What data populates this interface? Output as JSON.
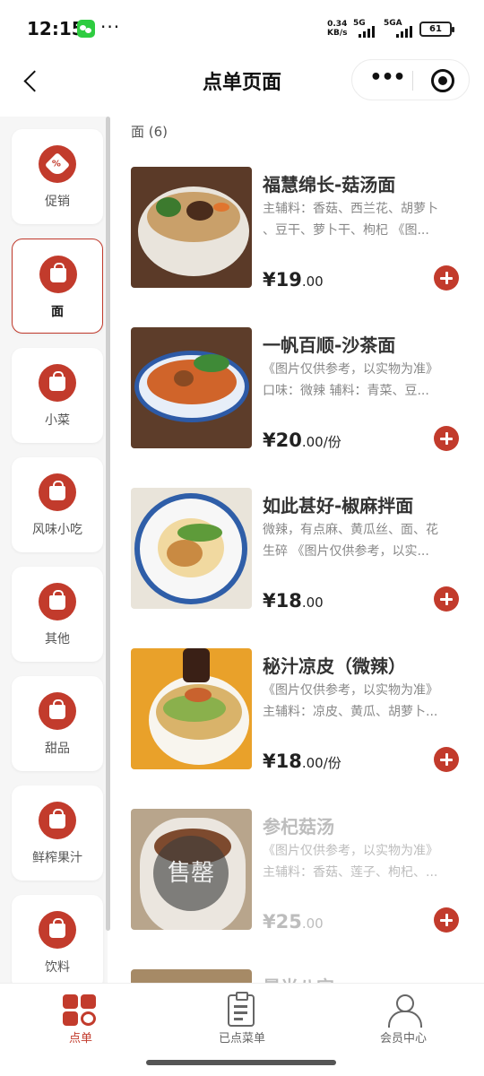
{
  "status_bar": {
    "time": "12:15",
    "dots": "···",
    "net_speed_value": "0.34",
    "net_speed_unit": "KB/s",
    "signal_1_label": "5G",
    "signal_2_label": "5GA",
    "battery": "61"
  },
  "header": {
    "title": "点单页面",
    "more_label": "•••"
  },
  "sidebar": {
    "categories": [
      {
        "label": "促销",
        "icon": "tag-icon"
      },
      {
        "label": "面",
        "icon": "bag-icon",
        "active": true
      },
      {
        "label": "小菜",
        "icon": "bag-icon"
      },
      {
        "label": "风味小吃",
        "icon": "bag-icon"
      },
      {
        "label": "其他",
        "icon": "bag-icon"
      },
      {
        "label": "甜品",
        "icon": "bag-icon"
      },
      {
        "label": "鲜榨果汁",
        "icon": "bag-icon"
      },
      {
        "label": "饮料",
        "icon": "bag-icon"
      }
    ]
  },
  "main": {
    "section_title": "面 (6)",
    "products": [
      {
        "name": "福慧绵长-菇汤面",
        "desc_1": "主辅料：香菇、西兰花、胡萝卜",
        "desc_2": "、豆干、萝卜干、枸杞 《图...",
        "price": "¥19",
        "cents": ".00",
        "unit": ""
      },
      {
        "name": "一帆百顺-沙茶面",
        "desc_1": "《图片仅供参考，以实物为准》",
        "desc_2": "口味：微辣 辅料：青菜、豆...",
        "price": "¥20",
        "cents": ".00",
        "unit": "/份"
      },
      {
        "name": "如此甚好-椒麻拌面",
        "desc_1": "微辣，有点麻、黄瓜丝、面、花",
        "desc_2": "生碎 《图片仅供参考，以实...",
        "price": "¥18",
        "cents": ".00",
        "unit": ""
      },
      {
        "name": "秘汁凉皮（微辣）",
        "desc_1": "《图片仅供参考，以实物为准》",
        "desc_2": "主辅料：凉皮、黄瓜、胡萝卜...",
        "price": "¥18",
        "cents": ".00",
        "unit": "/份"
      },
      {
        "name": "参杞菇汤",
        "desc_1": "《图片仅供参考，以实物为准》",
        "desc_2": "主辅料：香菇、莲子、枸杞、...",
        "price": "¥25",
        "cents": ".00",
        "unit": "",
        "soldout_label": "售罄"
      },
      {
        "name": "晨光八宝"
      }
    ]
  },
  "bottom_nav": {
    "items": [
      {
        "label": "点单",
        "icon": "order-grid-icon",
        "active": true
      },
      {
        "label": "已点菜单",
        "icon": "clipboard-icon"
      },
      {
        "label": "会员中心",
        "icon": "user-icon"
      }
    ]
  },
  "colors": {
    "accent": "#c23b2c",
    "muted_text": "#888888",
    "soldout_text": "#bdbdbd"
  }
}
